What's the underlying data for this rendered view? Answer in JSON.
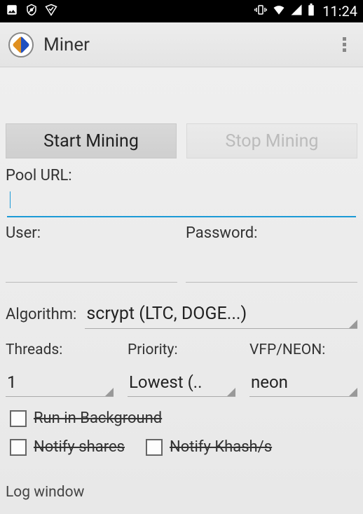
{
  "status": {
    "time": "11:24"
  },
  "appbar": {
    "title": "Miner"
  },
  "buttons": {
    "start": "Start Mining",
    "stop": "Stop Mining"
  },
  "form": {
    "pool_url_label": "Pool URL:",
    "pool_url_value": "",
    "user_label": "User:",
    "user_value": "",
    "password_label": "Password:",
    "password_value": "",
    "algorithm_label": "Algorithm:",
    "algorithm_value": "scrypt (LTC, DOGE...)",
    "threads_label": "Threads:",
    "threads_value": "1",
    "priority_label": "Priority:",
    "priority_value": "Lowest (..",
    "vfp_label": "VFP/NEON:",
    "vfp_value": "neon"
  },
  "checks": {
    "run_bg": "Run in Background",
    "notify_shares": "Notify shares",
    "notify_khash": "Notify Khash/s"
  },
  "log": {
    "label": "Log window"
  }
}
